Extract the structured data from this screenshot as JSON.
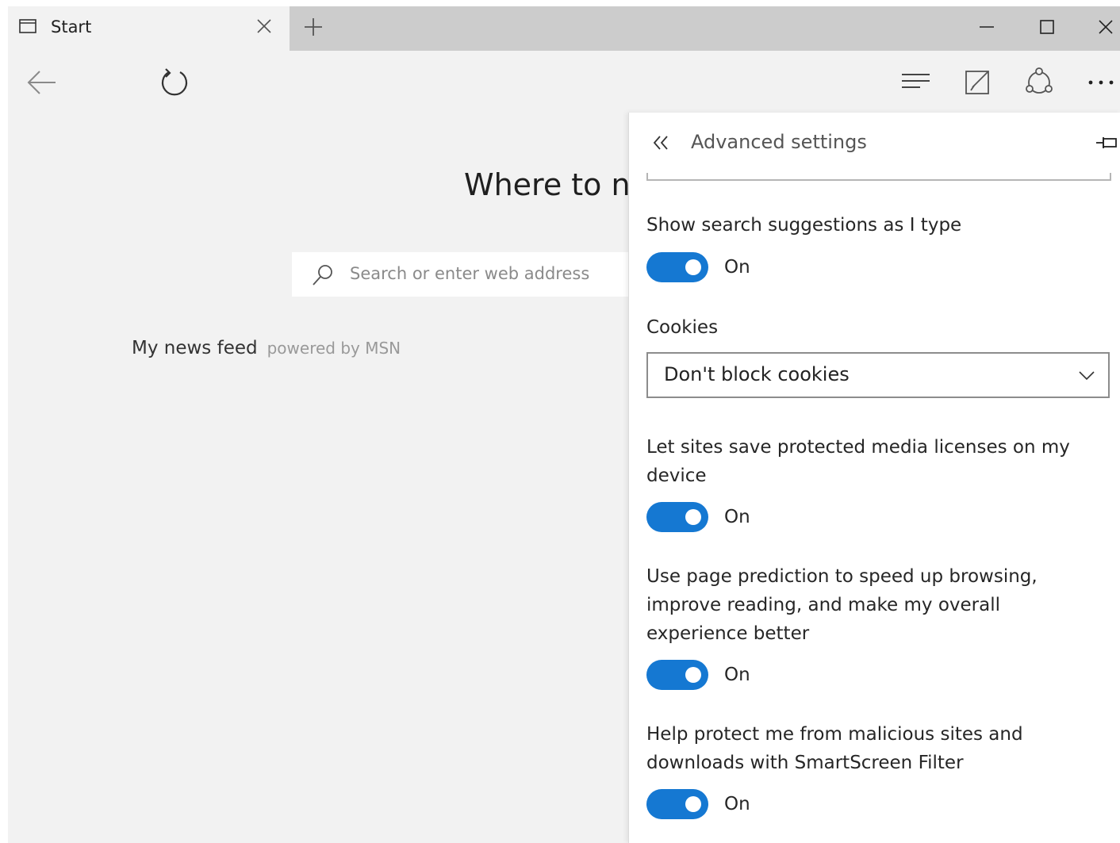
{
  "tab": {
    "title": "Start"
  },
  "page": {
    "heading": "Where to n",
    "search_placeholder": "Search or enter web address",
    "news_title": "My news feed",
    "news_powered": "powered by MSN"
  },
  "panel": {
    "title": "Advanced settings",
    "settings": [
      {
        "label": "Show search suggestions as I type",
        "state": "On"
      },
      {
        "label": "Cookies",
        "value": "Don't block cookies"
      },
      {
        "label": "Let sites save protected media licenses on my device",
        "state": "On"
      },
      {
        "label": "Use page prediction to speed up browsing, improve reading, and make my overall experience better",
        "state": "On"
      },
      {
        "label": "Help protect me from malicious sites and downloads with SmartScreen Filter",
        "state": "On"
      }
    ]
  },
  "colors": {
    "accent": "#1578d2",
    "chrome": "#f2f2f2",
    "tabbar": "#cccccc"
  },
  "icons": [
    "tab-page-icon",
    "close-icon",
    "plus-icon",
    "minimize-icon",
    "maximize-icon",
    "window-close-icon",
    "back-arrow-icon",
    "refresh-icon",
    "hub-icon",
    "web-note-icon",
    "share-icon",
    "more-icon",
    "search-icon",
    "double-chevron-left-icon",
    "pin-icon",
    "chevron-down-icon"
  ]
}
